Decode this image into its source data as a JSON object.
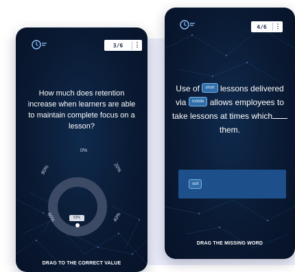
{
  "left_card": {
    "counter": "3/6",
    "menu_icon": "kebab-menu-icon",
    "logo_icon": "clock-menu-icon",
    "question": "How much does retention increase when learners are able to maintain complete focus on a lesson?",
    "gauge": {
      "labels": [
        "0%",
        "20%",
        "40%",
        "60%",
        "80%"
      ],
      "current_value": "53%",
      "value_fraction": 0.53
    },
    "footer": "DRAG TO THE CORRECT VALUE"
  },
  "right_card": {
    "counter": "4/6",
    "menu_icon": "kebab-menu-icon",
    "logo_icon": "clock-menu-icon",
    "sentence": {
      "part1": "Use of",
      "chip1": "short",
      "part2": "lessons delivered via",
      "chip2": "mobile",
      "part3": "allows employees to take lessons at times which",
      "part4": "them."
    },
    "word_bank": [
      "suit"
    ],
    "footer": "DRAG THE MISSING WORD"
  },
  "colors": {
    "card_bg": "#0a1a33",
    "chip_bg": "#2f6ea8",
    "word_bank_bg": "#1d4f8a",
    "gauge_track": "#3d4a66"
  }
}
